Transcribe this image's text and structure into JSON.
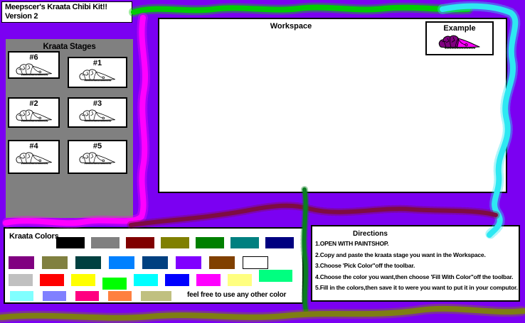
{
  "title_box": {
    "line1": "Meepscer's Kraata Chibi Kit!!",
    "line2": "Version 2"
  },
  "stages_panel": {
    "title": "Kraata Stages",
    "stages": [
      "#1",
      "#2",
      "#3",
      "#4",
      "#5",
      "#6"
    ]
  },
  "workspace": {
    "title": "Workspace",
    "example": {
      "title": "Example"
    }
  },
  "colors_panel": {
    "title": "Kraata Colors",
    "note": "feel free to use any other color",
    "rows": [
      [
        "#000000",
        "#808080",
        "#800000",
        "#808000",
        "#008000",
        "#008080",
        "#000080"
      ],
      [
        "#800080",
        "#808040",
        "#004040",
        "#0080FF",
        "#004080",
        "#8000FF",
        "#804000",
        "#FFFFFF"
      ],
      [
        "#C0C0C0",
        "#FF0000",
        "#FFFF00",
        "#00FF00",
        "#00FFFF",
        "#0000FF",
        "#FF00FF",
        "#FFFF80",
        "#00FF80"
      ],
      [
        "#80FFFF",
        "#8080FF",
        "#FF0080",
        "#FF8040",
        "#C0C080"
      ]
    ]
  },
  "directions_panel": {
    "title": "Directions",
    "steps": [
      "1.OPEN WITH PAINTSHOP.",
      "2.Copy and paste the kraata stage you want in the Workspace.",
      "3.Choose 'Pick Color''off the toolbar.",
      "4.Choose the color you want,then choose 'Fill With Color''off the toolbar.",
      "5.Fill in the colors,then save it to were you want to put it in your computor."
    ]
  },
  "example_kraata": {
    "head_color": "#800080",
    "body_color": "#FF00FF"
  },
  "palette": {
    "background": "#7B00F2",
    "panel_gray": "#808080",
    "green_marker": "#00CC00",
    "cyan_marker": "#2EE8F2",
    "magenta_marker": "#FF00FF",
    "maroon_marker": "#7D0C42",
    "dark_green_marker": "#0B7D20",
    "olive_marker": "#7E7E12"
  }
}
